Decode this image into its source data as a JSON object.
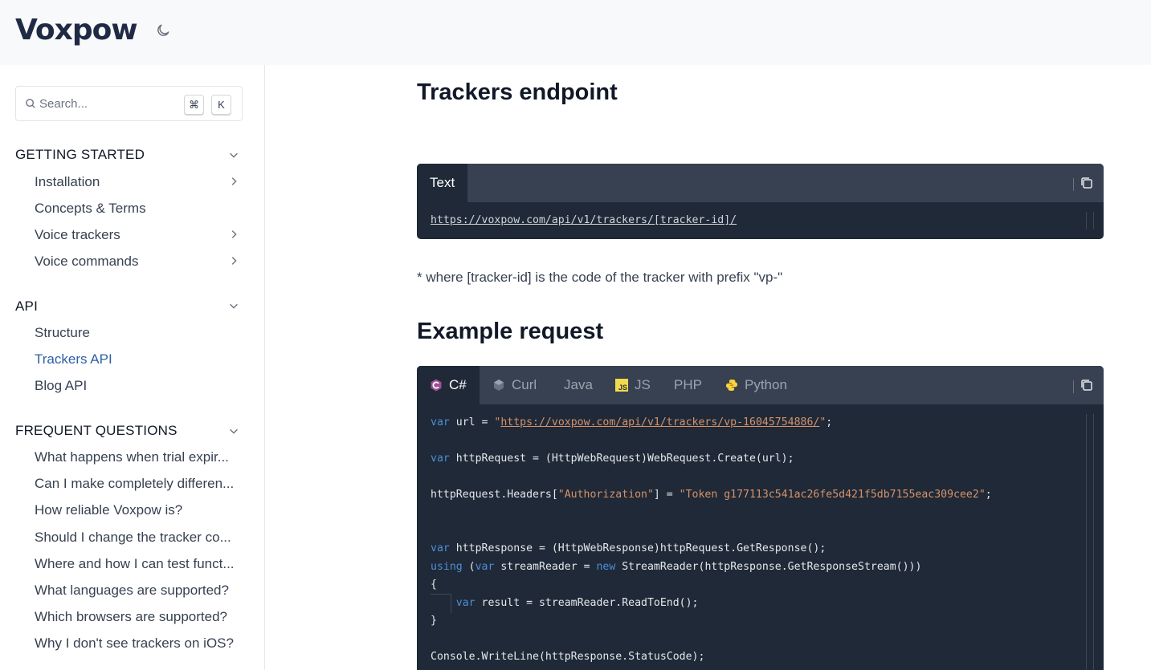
{
  "brand": {
    "logo_text": "Voxpow"
  },
  "header": {
    "theme_toggle_icon": "moon-icon"
  },
  "search": {
    "placeholder": "Search...",
    "shortcut_mod": "⌘",
    "shortcut_key": "K"
  },
  "sidebar": {
    "sections": [
      {
        "title": "GETTING STARTED",
        "items": [
          {
            "label": "Installation",
            "has_children": true
          },
          {
            "label": "Concepts & Terms",
            "has_children": false
          },
          {
            "label": "Voice trackers",
            "has_children": true
          },
          {
            "label": "Voice commands",
            "has_children": true
          }
        ]
      },
      {
        "title": "API",
        "items": [
          {
            "label": "Structure",
            "active": false
          },
          {
            "label": "Trackers API",
            "active": true
          },
          {
            "label": "Blog API",
            "active": false
          }
        ]
      },
      {
        "title": "FREQUENT QUESTIONS",
        "items": [
          {
            "label": "What happens when trial expir..."
          },
          {
            "label": "Can I make completely differen..."
          },
          {
            "label": "How reliable Voxpow is?"
          },
          {
            "label": "Should I change the tracker co..."
          },
          {
            "label": "Where and how I can test funct..."
          },
          {
            "label": "What languages are supported?"
          },
          {
            "label": "Which browsers are supported?"
          },
          {
            "label": "Why I don't see trackers on iOS?"
          }
        ]
      }
    ]
  },
  "main": {
    "title": "Trackers endpoint",
    "endpoint_block": {
      "tab": "Text",
      "url": "https://voxpow.com/api/v1/trackers/[tracker-id]/"
    },
    "note": "* where [tracker-id] is the code of the tracker with prefix \"vp-\"",
    "example_title": "Example request",
    "example_block": {
      "tabs": [
        {
          "label": "C#",
          "icon": "csharp-icon",
          "active": true
        },
        {
          "label": "Curl",
          "icon": "curl-icon",
          "active": false
        },
        {
          "label": "Java",
          "icon": "",
          "active": false
        },
        {
          "label": "JS",
          "icon": "js-icon",
          "active": false
        },
        {
          "label": "PHP",
          "icon": "",
          "active": false
        },
        {
          "label": "Python",
          "icon": "python-icon",
          "active": false
        }
      ],
      "code": {
        "l1_kw": "var",
        "l1_a": " url = ",
        "l1_q1": "\"",
        "l1_url": "https://voxpow.com/api/v1/trackers/vp-16045754886/",
        "l1_q2": "\"",
        "l1_end": ";",
        "l2_kw": "var",
        "l2_rest": " httpRequest = (HttpWebRequest)WebRequest.Create(url);",
        "l3_a": "httpRequest.Headers[",
        "l3_s1": "\"Authorization\"",
        "l3_b": "] = ",
        "l3_s2": "\"Token g177113c541ac26fe5d421f5db7155eac309cee2\"",
        "l3_end": ";",
        "l4_kw": "var",
        "l4_rest": " httpResponse = (HttpWebResponse)httpRequest.GetResponse();",
        "l5_kw1": "using",
        "l5_a": " (",
        "l5_kw2": "var",
        "l5_b": " streamReader = ",
        "l5_kw3": "new",
        "l5_c": " StreamReader(httpResponse.GetResponseStream()))",
        "l6": "{",
        "l7_indent": "    ",
        "l7_kw": "var",
        "l7_rest": " result = streamReader.ReadToEnd();",
        "l8": "}",
        "l9": "Console.WriteLine(httpResponse.StatusCode);"
      }
    },
    "colors": {
      "code_bg": "#1f2937",
      "code_header": "#374151",
      "accent": "#2c5fa3",
      "keyword": "#4f8fd6",
      "string": "#d6926a"
    }
  }
}
